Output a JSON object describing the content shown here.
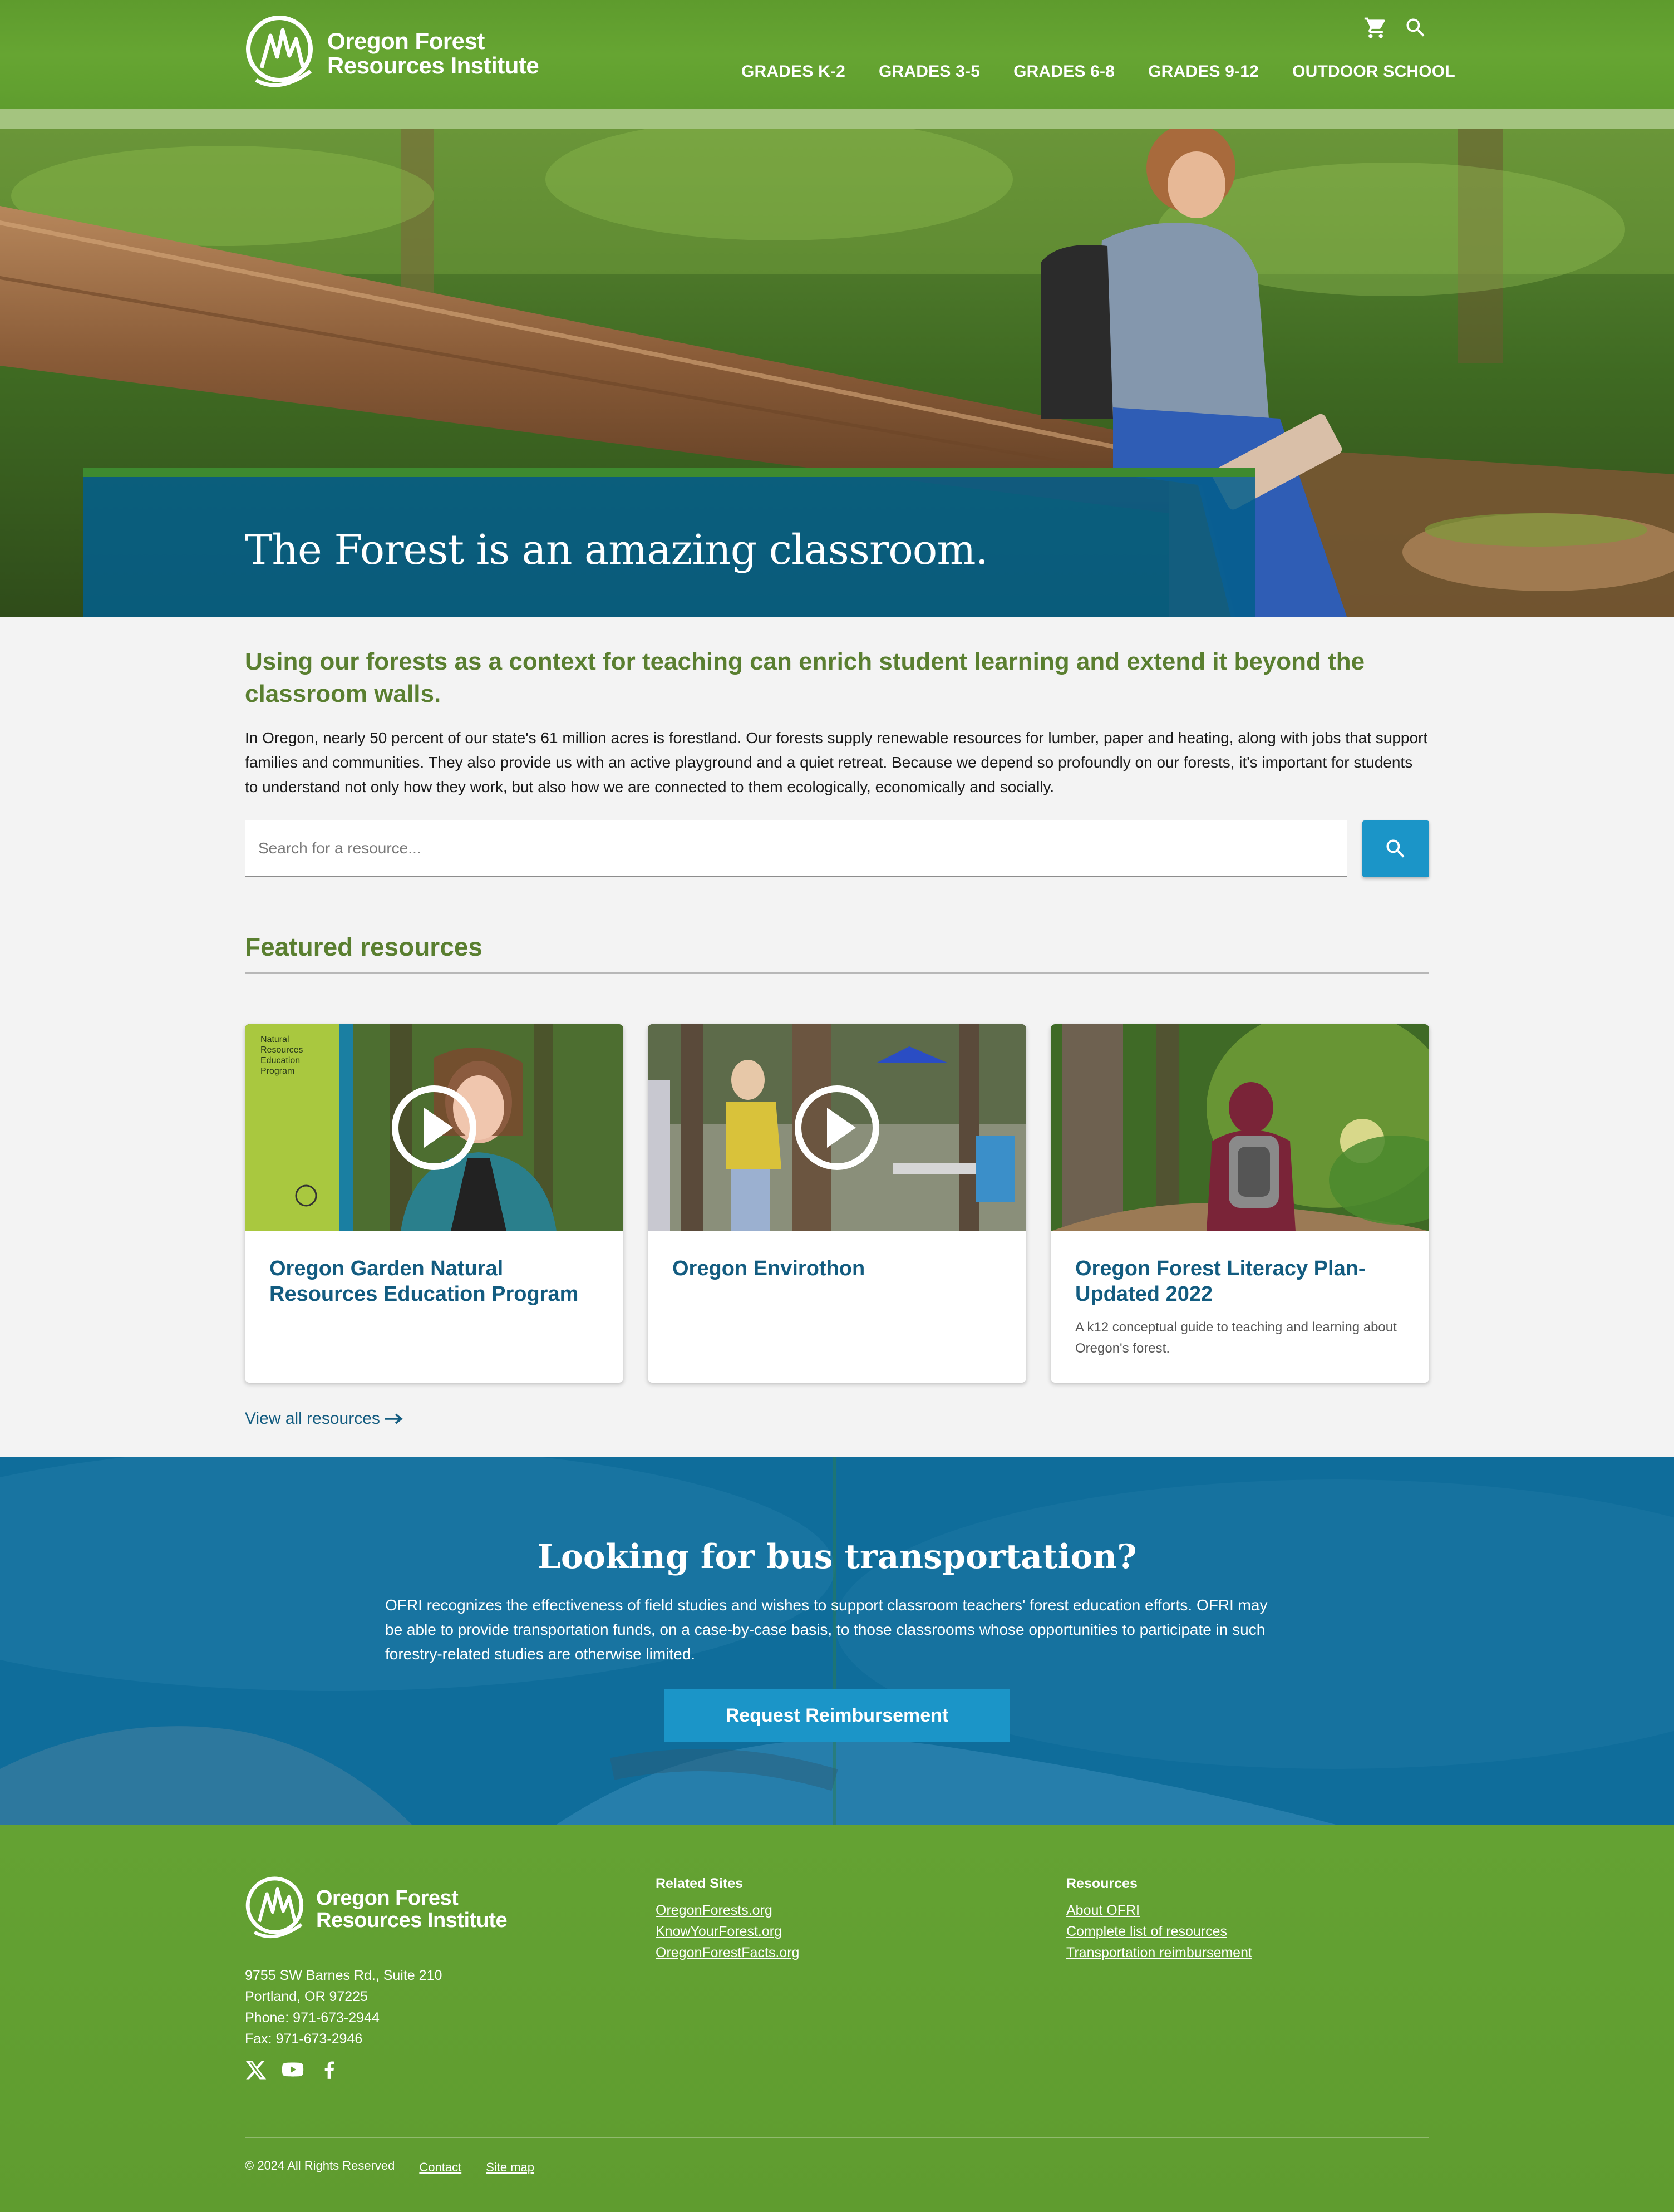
{
  "brand": {
    "name_line1": "Oregon Forest",
    "name_line2": "Resources Institute",
    "green": "#66a532",
    "blue": "#1b95c8",
    "dark_blue": "#135c80"
  },
  "header": {
    "utility_icons": [
      "cart-icon",
      "search-icon"
    ],
    "nav": [
      {
        "label": "GRADES K-2"
      },
      {
        "label": "GRADES 3-5"
      },
      {
        "label": "GRADES 6-8"
      },
      {
        "label": "GRADES 9-12"
      },
      {
        "label": "OUTDOOR SCHOOL"
      }
    ]
  },
  "hero": {
    "title": "The Forest is an amazing classroom."
  },
  "intro": {
    "heading": "Using our forests as a context for teaching can enrich student learning and extend it beyond the classroom walls.",
    "body": "In Oregon, nearly 50 percent of our state's 61 million acres is forestland. Our forests supply renewable resources for lumber, paper and heating, along with jobs that support families and communities. They also provide us with an active playground and a quiet retreat. Because we depend so profoundly on our forests, it's important for students to understand not only how they work, but also how we are connected to them ecologically, economically and socially."
  },
  "search": {
    "placeholder": "Search for a resource...",
    "value": ""
  },
  "featured": {
    "heading": "Featured resources",
    "cards": [
      {
        "title": "Oregon Garden Natural Resources Education Program",
        "description": "",
        "video": true,
        "badge_text": "Natural Resources Education Program"
      },
      {
        "title": "Oregon Envirothon",
        "description": "",
        "video": true
      },
      {
        "title": "Oregon Forest Literacy Plan- Updated 2022",
        "description": "A k12 conceptual guide to teaching and learning about Oregon's forest.",
        "video": false
      }
    ],
    "view_all": "View all resources"
  },
  "bus": {
    "title": "Looking for bus transportation?",
    "text": "OFRI recognizes the effectiveness of field studies and wishes to support classroom teachers' forest education efforts. OFRI may be able to provide transportation funds, on a case-by-case basis, to those classrooms whose opportunities to participate in such forestry-related studies are otherwise limited.",
    "button": "Request Reimbursement"
  },
  "footer": {
    "address": [
      "9755 SW Barnes Rd., Suite 210",
      "Portland, OR 97225",
      "Phone: 971-673-2944",
      "Fax: 971-673-2946"
    ],
    "social": [
      "x-icon",
      "youtube-icon",
      "facebook-icon"
    ],
    "related_title": "Related Sites",
    "related": [
      "OregonForests.org",
      "KnowYourForest.org",
      "OregonForestFacts.org"
    ],
    "resources_title": "Resources",
    "resources": [
      "About OFRI",
      "Complete list of resources",
      "Transportation reimbursement"
    ],
    "copyright": "© 2024 All Rights Reserved",
    "bottom_links": [
      "Contact",
      "Site map"
    ]
  }
}
